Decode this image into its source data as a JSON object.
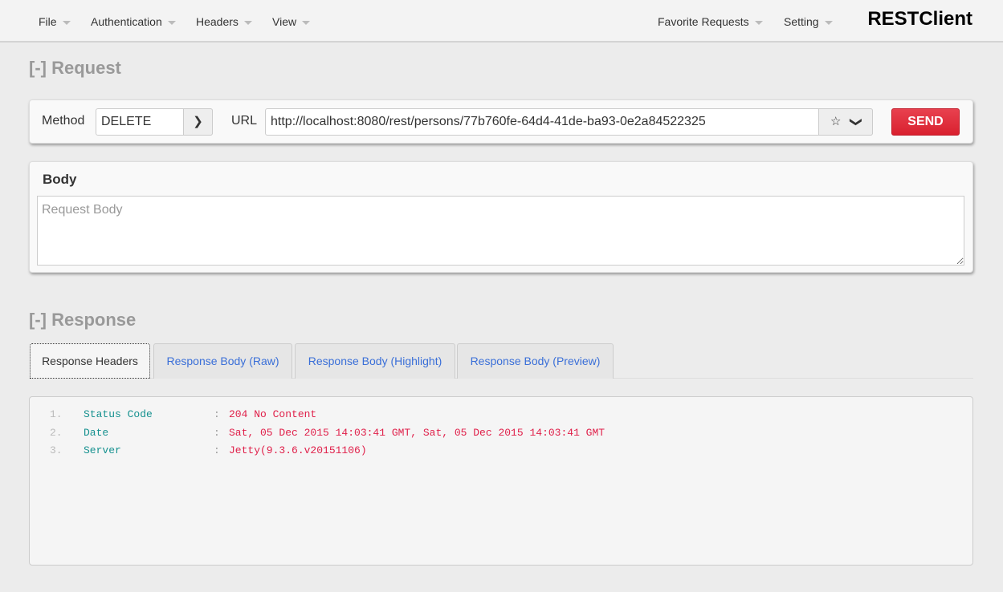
{
  "nav": {
    "left": [
      "File",
      "Authentication",
      "Headers",
      "View"
    ],
    "right": [
      "Favorite Requests",
      "Setting"
    ],
    "brand": "RESTClient"
  },
  "request": {
    "title": "[-] Request",
    "method_label": "Method",
    "method": "DELETE",
    "url_label": "URL",
    "url": "http://localhost:8080/rest/persons/77b760fe-64d4-41de-ba93-0e2a84522325",
    "send": "SEND",
    "body_title": "Body",
    "body_placeholder": "Request Body",
    "accent": "#e0283a"
  },
  "response": {
    "title": "[-] Response",
    "tabs": [
      "Response Headers",
      "Response Body (Raw)",
      "Response Body (Highlight)",
      "Response Body (Preview)"
    ],
    "active_tab": 0,
    "headers": [
      {
        "n": "1.",
        "k": "Status Code",
        "v": "204 No Content"
      },
      {
        "n": "2.",
        "k": "Date",
        "v": "Sat, 05 Dec 2015 14:03:41 GMT, Sat, 05 Dec 2015 14:03:41 GMT"
      },
      {
        "n": "3.",
        "k": "Server",
        "v": "Jetty(9.3.6.v20151106)"
      }
    ],
    "separator": ":"
  }
}
